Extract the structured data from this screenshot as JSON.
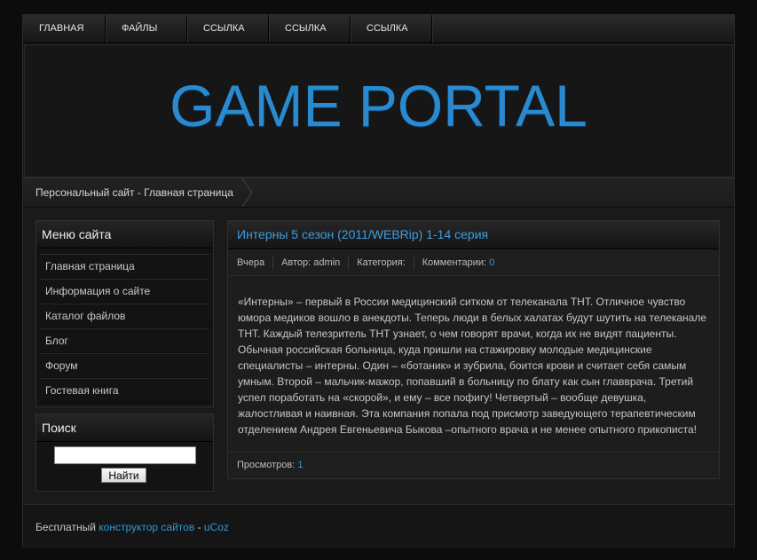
{
  "nav": {
    "items": [
      "ГЛАВНАЯ",
      "ФАЙЛЫ",
      "ССЫЛКА",
      "ССЫЛКА",
      "ССЫЛКА"
    ]
  },
  "header": {
    "logo_text": "GAME PORTAL"
  },
  "breadcrumb": {
    "text": "Персональный сайт - Главная страница"
  },
  "sidebar": {
    "menu_title": "Меню сайта",
    "menu_items": [
      "Главная страница",
      "Информация о сайте",
      "Каталог файлов",
      "Блог",
      "Форум",
      "Гостевая книга"
    ],
    "search_title": "Поиск",
    "search_value": "",
    "search_button": "Найти"
  },
  "post": {
    "title": "Интерны 5 сезон (2011/WEBRip) 1-14 серия",
    "date": "Вчера",
    "author": "Автор: admin",
    "category": "Категория:",
    "comments_label": "Комментарии:",
    "comments_count": "0",
    "body": "«Интерны» – первый в России медицинский ситком от телеканала ТНТ. Отличное чувство юмора медиков вошло в анекдоты. Теперь люди в белых халатах будут шутить на телеканале ТНТ. Каждый телезритель ТНТ узнает, о чем говорят врачи, когда их не видят пациенты. Обычная российская больница, куда пришли на стажировку молодые медицинские специалисты – интерны. Один – «ботаник» и зубрила, боится крови и считает себя самым умным. Второй – мальчик-мажор, попавший в больницу по блату как сын главврача. Третий успел поработать на «скорой», и ему – все пофигу! Четвертый – вообще девушка, жалостливая и наивная. Эта компания попала под присмотр заведующего терапевтическим отделением Андрея Евгеньевича Быкова –опытного врача и не менее опытного прикописта!",
    "views_label": "Просмотров:",
    "views_count": "1"
  },
  "footer": {
    "prefix": "Бесплатный",
    "link1": "конструктор сайтов",
    "separator": "-",
    "link2": "uCoz"
  },
  "colors": {
    "accent": "#2f98d8",
    "logo": "#2a8ad0",
    "background": "#1a1a1a"
  }
}
